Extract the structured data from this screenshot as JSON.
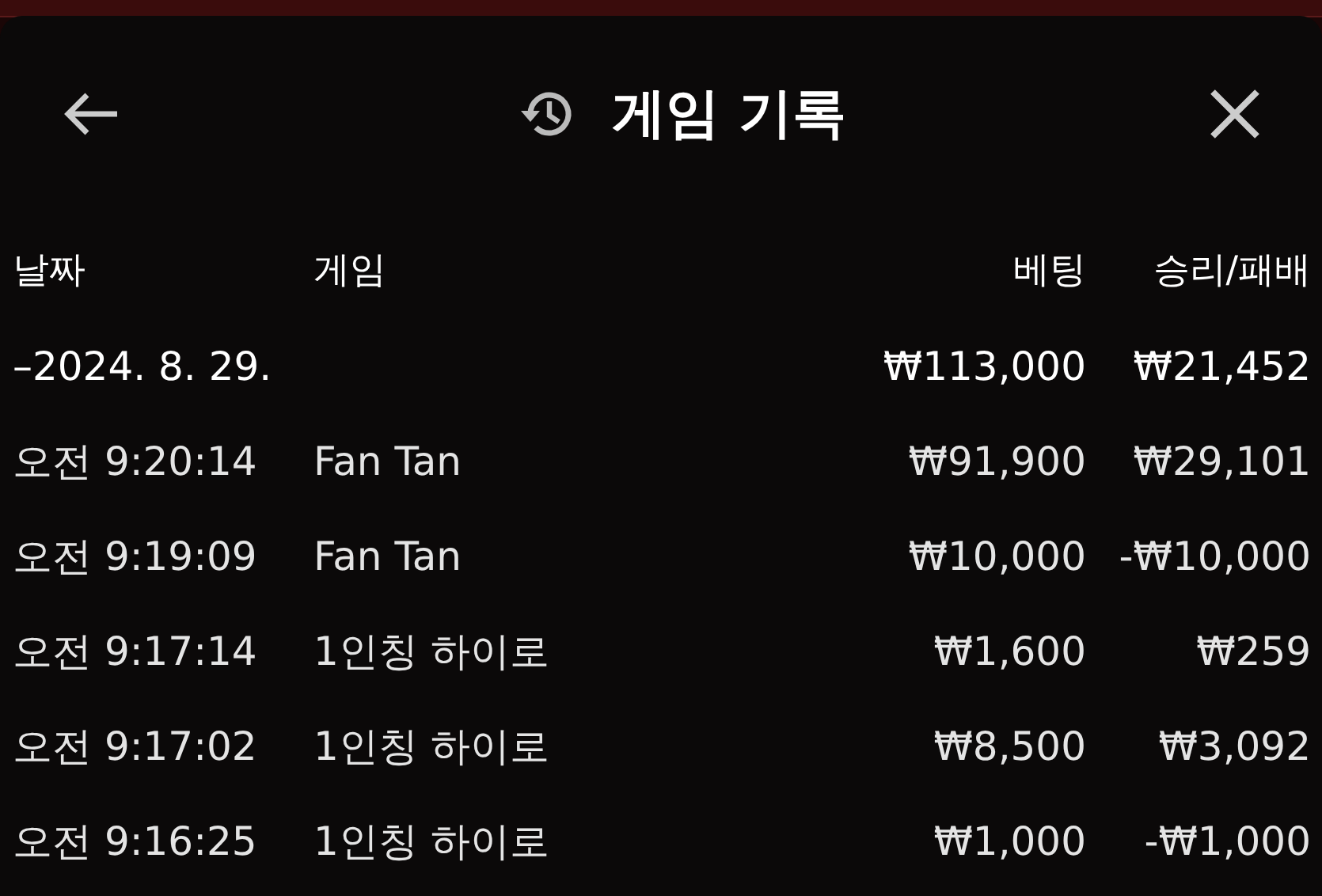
{
  "header": {
    "title": "게임 기록"
  },
  "table": {
    "columns": [
      "날짜",
      "게임",
      "베팅",
      "승리/패배"
    ],
    "summary": {
      "date": "–2024. 8. 29.",
      "bet": "₩113,000",
      "result": "₩21,452"
    },
    "rows": [
      {
        "time": "오전 9:20:14",
        "game": "Fan Tan",
        "bet": "₩91,900",
        "result": "₩29,101"
      },
      {
        "time": "오전 9:19:09",
        "game": "Fan Tan",
        "bet": "₩10,000",
        "result": "-₩10,000"
      },
      {
        "time": "오전 9:17:14",
        "game": "1인칭 하이로",
        "bet": "₩1,600",
        "result": "₩259"
      },
      {
        "time": "오전 9:17:02",
        "game": "1인칭 하이로",
        "bet": "₩8,500",
        "result": "₩3,092"
      },
      {
        "time": "오전 9:16:25",
        "game": "1인칭 하이로",
        "bet": "₩1,000",
        "result": "-₩1,000"
      }
    ]
  }
}
